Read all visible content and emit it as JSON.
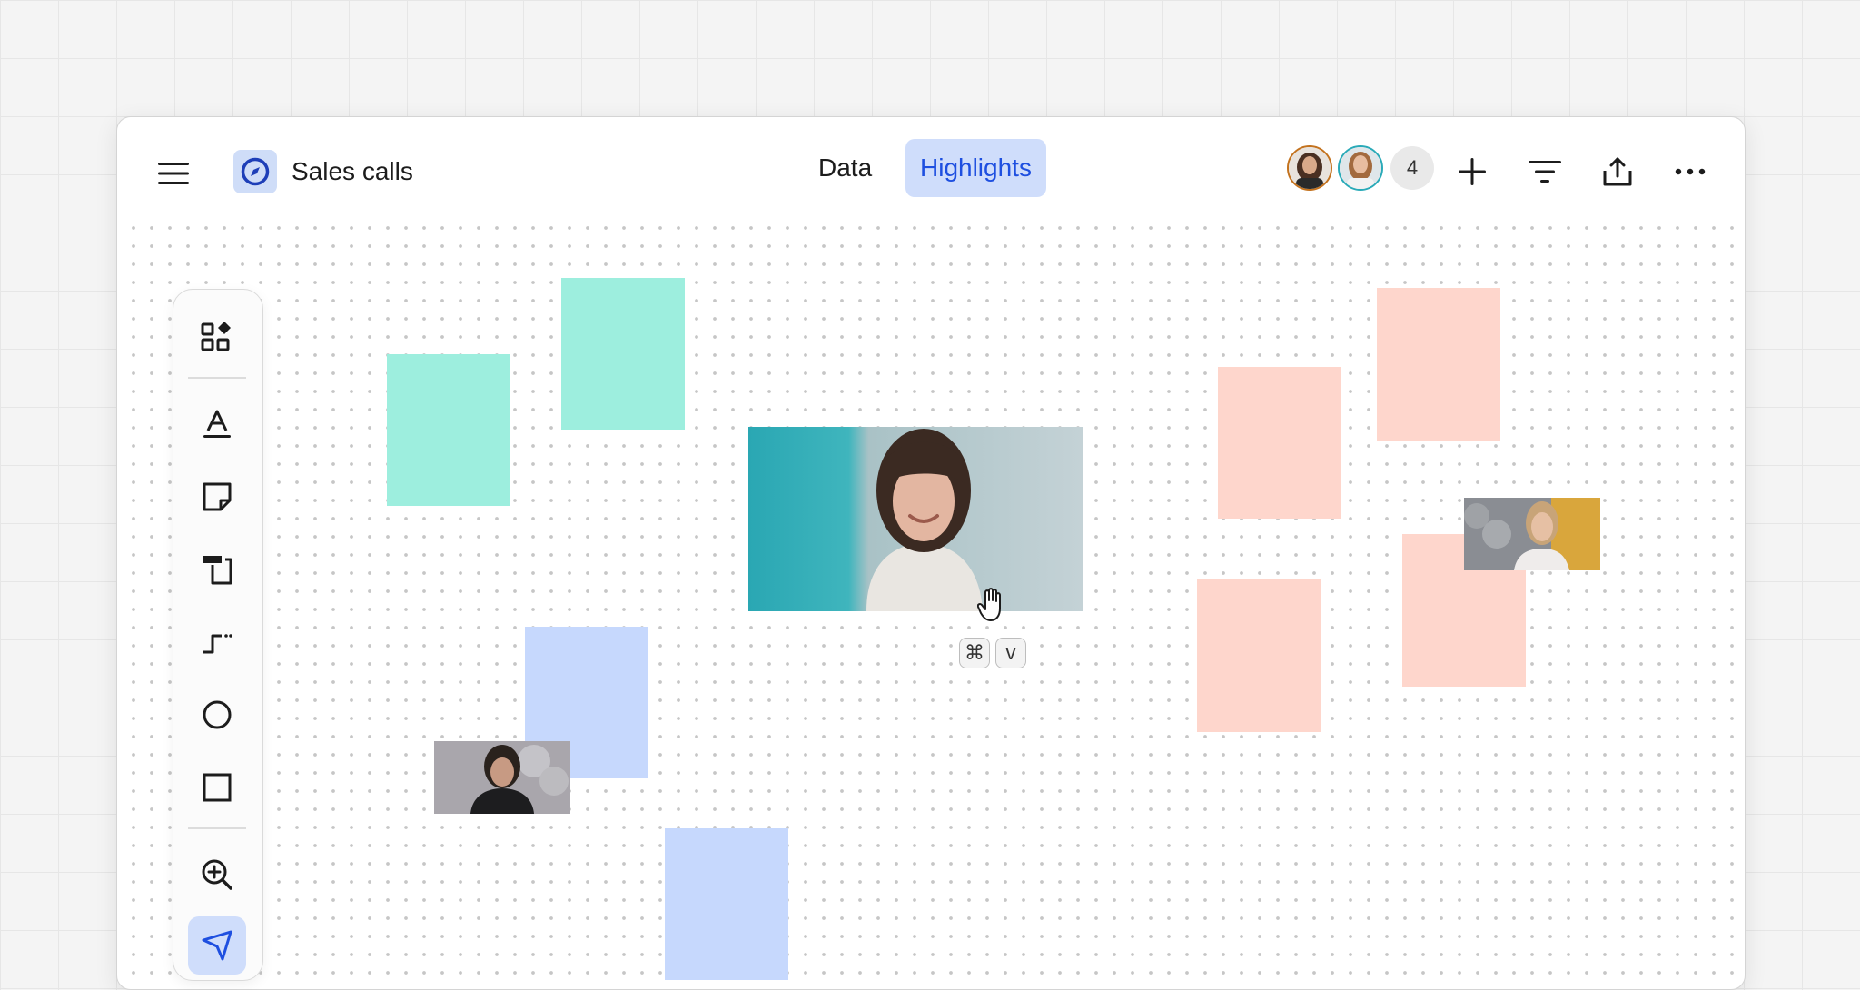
{
  "app": {
    "title": "Sales calls",
    "menu_icon": "hamburger-menu-icon",
    "app_icon": "compass-icon"
  },
  "tabs": [
    {
      "label": "Data",
      "active": false
    },
    {
      "label": "Highlights",
      "active": true
    }
  ],
  "collaborators": {
    "count": "4"
  },
  "toolbar": {
    "tools": [
      "components-icon",
      "text-icon",
      "sticky-note-icon",
      "frame-icon",
      "connector-icon",
      "circle-icon",
      "rectangle-icon",
      "zoom-in-icon",
      "select-arrow-icon"
    ],
    "active_tool": "select-arrow-icon"
  },
  "shortcut": {
    "key1": "⌘",
    "key2": "v"
  },
  "colors": {
    "accent": "#1e4fe0",
    "tab_active_bg": "#cfddfb",
    "note_green": "#9deede",
    "note_blue": "#c6d8fd",
    "note_pink": "#fed6cc"
  }
}
